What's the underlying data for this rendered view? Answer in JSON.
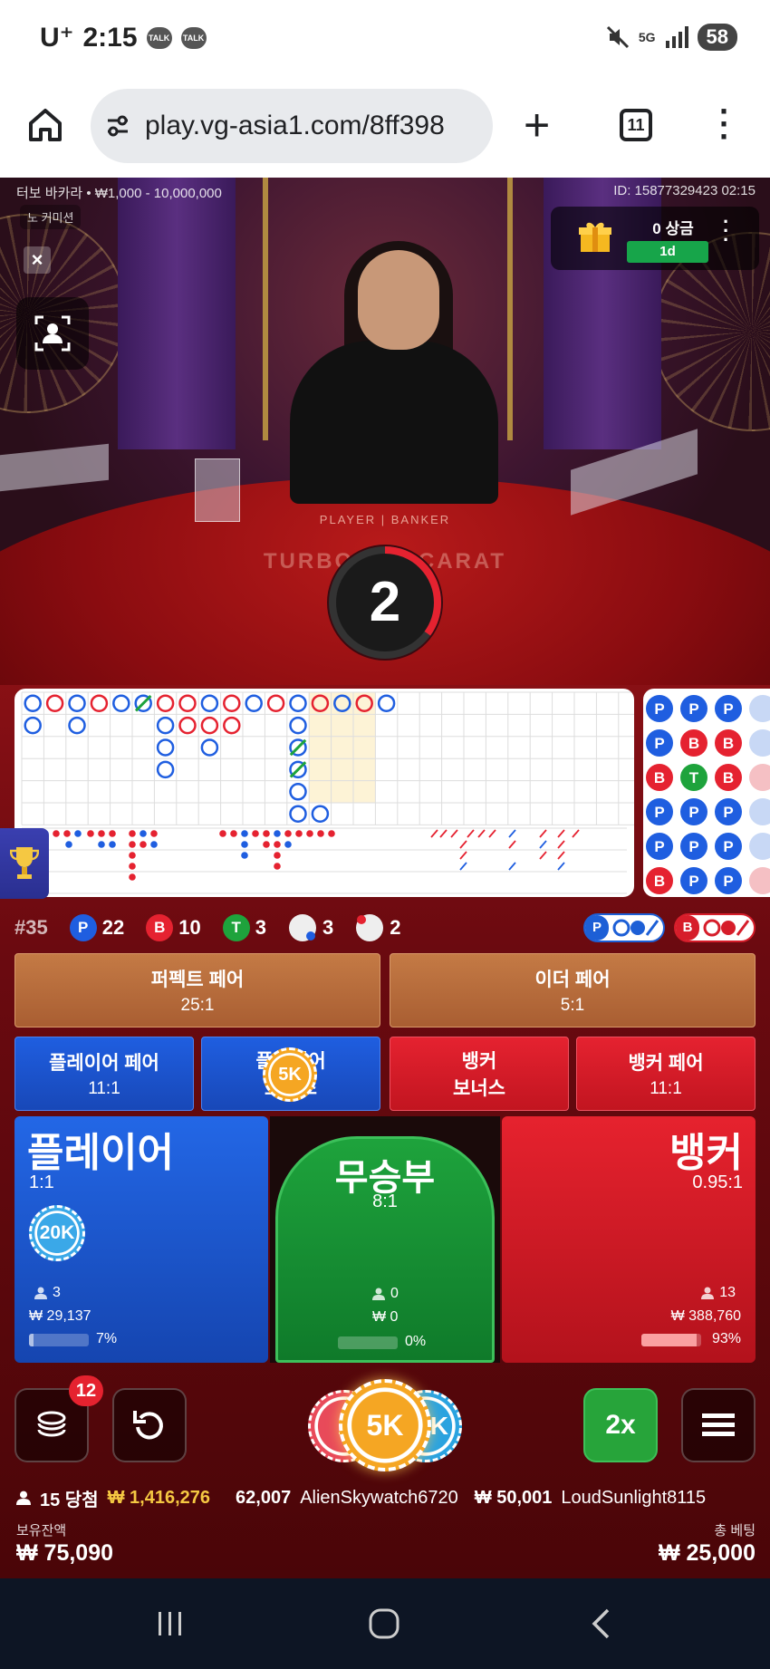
{
  "status_bar": {
    "carrier": "U⁺",
    "time": "2:15",
    "talk1": "TALK",
    "talk2": "TALK",
    "network": "5G",
    "battery": "58"
  },
  "browser": {
    "url": "play.vg-asia1.com/8ff398",
    "tab_count": "11"
  },
  "game": {
    "table_name": "터보 바카라 • ₩1,000 - 10,000,000",
    "game_id": "ID: 15877329423 02:15",
    "commission_label": "노 커미션",
    "reward_count": "0 상금",
    "reward_period": "1d",
    "table_print_top": "PLAYER | BANKER",
    "table_print_name": "TURBO BACCARAT",
    "countdown": "2",
    "countdown_fraction": 0.35
  },
  "bead_road": [
    [
      "P",
      "P",
      "P"
    ],
    [
      "P",
      "B",
      "B"
    ],
    [
      "B",
      "T",
      "B"
    ],
    [
      "P",
      "P",
      "P"
    ],
    [
      "P",
      "P",
      "P"
    ],
    [
      "B",
      "P",
      "P"
    ]
  ],
  "stats": {
    "round": "#35",
    "player_label": "P",
    "player_count": "22",
    "banker_label": "B",
    "banker_count": "10",
    "tie_label": "T",
    "tie_count": "3",
    "player_pair_count": "3",
    "banker_pair_count": "2",
    "ask_player": "P",
    "ask_banker": "B"
  },
  "bets": {
    "perfect_pair": {
      "label": "퍼펙트 페어",
      "odds": "25:1"
    },
    "either_pair": {
      "label": "이더 페어",
      "odds": "5:1"
    },
    "player_pair": {
      "label": "플레이어 페어",
      "odds": "11:1"
    },
    "player_bonus": {
      "label": "플레이어",
      "odds": "보너스"
    },
    "banker_bonus": {
      "label": "뱅커",
      "odds": "보너스"
    },
    "banker_pair": {
      "label": "뱅커 페어",
      "odds": "11:1"
    },
    "player": {
      "label": "플레이어",
      "odds": "1:1",
      "bettors": "3",
      "amount": "₩ 29,137",
      "percent": "7%",
      "percent_value": 0.07
    },
    "tie": {
      "label": "무승부",
      "odds": "8:1",
      "bettors": "0",
      "amount": "₩ 0",
      "percent": "0%",
      "percent_value": 0
    },
    "banker": {
      "label": "뱅커",
      "odds": "0.95:1",
      "bettors": "13",
      "amount": "₩ 388,760",
      "percent": "93%",
      "percent_value": 0.93
    }
  },
  "chips": {
    "player_chip": "20K",
    "bonus_chip": "5K",
    "selected_chip": "5K",
    "left_chip": "1",
    "right_chip": "K"
  },
  "controls": {
    "chips_badge": "12",
    "double_label": "2x"
  },
  "ticker": {
    "winners_label": "15 당첨",
    "winners_total": "₩ 1,416,276",
    "entry1_amount": "62,007",
    "entry2_name": "AlienSkywatch6720",
    "entry2_amount": "₩ 50,001",
    "entry3_name": "LoudSunlight8115"
  },
  "footer": {
    "balance_label": "보유잔액",
    "balance": "₩ 75,090",
    "total_bet_label": "총 베팅",
    "total_bet": "₩ 25,000"
  },
  "colors": {
    "player": "#1f5ee0",
    "banker": "#e52230",
    "tie": "#1ea33c",
    "side": "#c47a45",
    "accent_gold": "#f5a623"
  }
}
